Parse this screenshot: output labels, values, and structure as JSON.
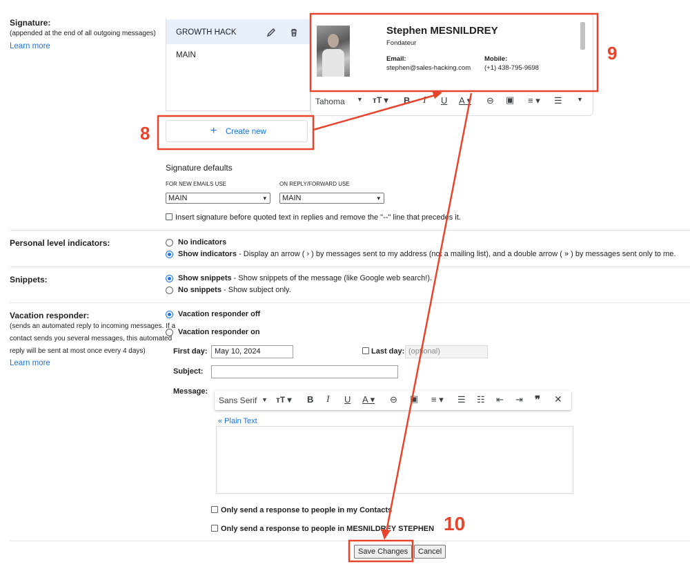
{
  "signature": {
    "label": "Signature:",
    "note": "(appended at the end of all outgoing messages)",
    "learn_more": "Learn more",
    "items": [
      {
        "name": "GROWTH HACK"
      },
      {
        "name": "MAIN"
      }
    ],
    "create_new": "Create new",
    "preview": {
      "name": "Stephen MESNILDREY",
      "role": "Fondateur",
      "email_label": "Email:",
      "email": "stephen@sales-hacking.com",
      "mobile_label": "Mobile:",
      "mobile": "(+1) 438-795-9698"
    },
    "toolbar_font": "Tahoma",
    "defaults_title": "Signature defaults",
    "new_emails_label": "FOR NEW EMAILS USE",
    "new_emails_value": "MAIN",
    "reply_label": "ON REPLY/FORWARD USE",
    "reply_value": "MAIN",
    "insert_before": "Insert signature before quoted text in replies and remove the \"--\" line that precedes it."
  },
  "personal": {
    "label": "Personal level indicators:",
    "opt1": "No indicators",
    "opt2": "Show indicators",
    "opt2_desc": " - Display an arrow ( › ) by messages sent to my address (not a mailing list), and a double arrow ( » ) by messages sent only to me."
  },
  "snippets": {
    "label": "Snippets:",
    "opt1": "Show snippets",
    "opt1_desc": " - Show snippets of the message (like Google web search!).",
    "opt2": "No snippets",
    "opt2_desc": " - Show subject only."
  },
  "vacation": {
    "label": "Vacation responder:",
    "note1": "(sends an automated reply to incoming messages. If a",
    "note2": "contact sends you several messages, this automated",
    "note3": "reply will be sent at most once every 4 days)",
    "learn_more": "Learn more",
    "off": "Vacation responder off",
    "on": "Vacation responder on",
    "first_day_label": "First day:",
    "first_day_value": "May 10, 2024",
    "last_day_label": "Last day:",
    "last_day_placeholder": "(optional)",
    "subject_label": "Subject:",
    "message_label": "Message:",
    "toolbar_font": "Sans Serif",
    "plain_text": "« Plain Text",
    "only_contacts": "Only send a response to people in my Contacts",
    "only_domain": "Only send a response to people in MESNILDREY STEPHEN"
  },
  "actions": {
    "save": "Save Changes",
    "cancel": "Cancel"
  },
  "annotations": {
    "n8": "8",
    "n9": "9",
    "n10": "10",
    "color": "#e8442c"
  }
}
